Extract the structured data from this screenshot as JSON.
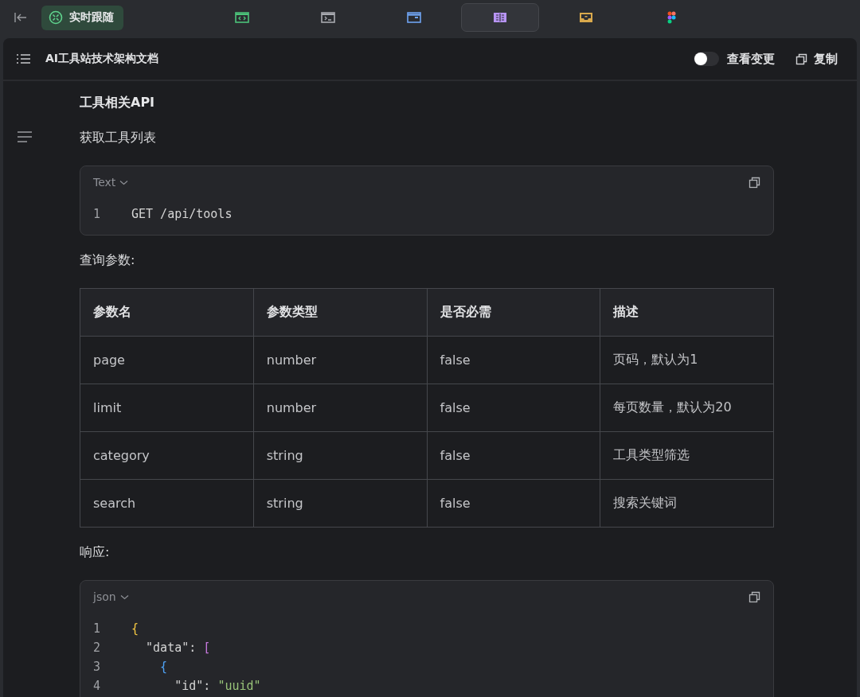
{
  "toolbar": {
    "follow_button": {
      "label": "实时跟随",
      "selected": true
    },
    "tabs": [
      {
        "kind": "code",
        "selected": false
      },
      {
        "kind": "terminal",
        "selected": false
      },
      {
        "kind": "window",
        "selected": false
      },
      {
        "kind": "document",
        "selected": true
      },
      {
        "kind": "inbox",
        "selected": false
      },
      {
        "kind": "figma",
        "selected": false
      }
    ]
  },
  "header": {
    "title": "AI工具站技术架构文档",
    "view_changes": {
      "label": "查看变更",
      "on": false
    },
    "copy_button": "复制"
  },
  "content": {
    "heading": "工具相关API",
    "subheading": "获取工具列表",
    "request_block": {
      "language": "Text",
      "lines": [
        {
          "number": "1",
          "tokens": [
            {
              "text": "GET /api/tools",
              "color": "#d4d4d4"
            }
          ]
        }
      ]
    },
    "params_label": "查询参数:",
    "table": {
      "columns": [
        "参数名",
        "参数类型",
        "是否必需",
        "描述"
      ],
      "rows": [
        [
          "page",
          "number",
          "false",
          "页码，默认为1"
        ],
        [
          "limit",
          "number",
          "false",
          "每页数量，默认为20"
        ],
        [
          "category",
          "string",
          "false",
          "工具类型筛选"
        ],
        [
          "search",
          "string",
          "false",
          "搜索关键词"
        ]
      ]
    },
    "response_label": "响应:",
    "response_block": {
      "language": "json",
      "lines": [
        {
          "number": "1",
          "tokens": [
            {
              "text": "{",
              "color": "#f5c842"
            }
          ]
        },
        {
          "number": "2",
          "tokens": [
            {
              "text": "  \"data\": ",
              "color": "#d4d4d4"
            },
            {
              "text": "[",
              "color": "#c678dd"
            }
          ]
        },
        {
          "number": "3",
          "tokens": [
            {
              "text": "    {",
              "color": "#4fa3f7"
            }
          ]
        },
        {
          "number": "4",
          "tokens": [
            {
              "text": "      \"id\": ",
              "color": "#d4d4d4"
            },
            {
              "text": "\"uuid\"",
              "color": "#98c379"
            }
          ]
        }
      ]
    }
  }
}
